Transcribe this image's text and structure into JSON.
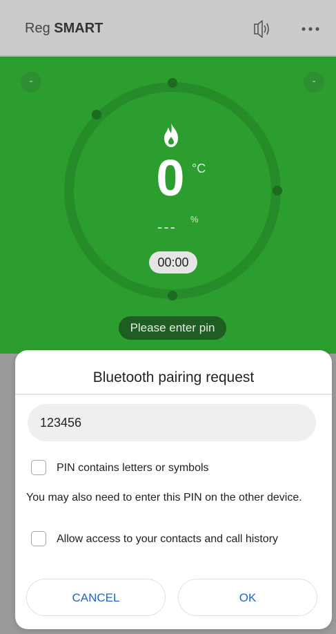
{
  "app_bar": {
    "title_prefix": "Reg ",
    "title_bold": "SMART",
    "speaker_icon": "speaker-icon",
    "more_icon": "more-icon"
  },
  "thermostat": {
    "corner_left": "-",
    "corner_right": "-",
    "flame_icon": "flame-icon",
    "temperature": "0",
    "temperature_unit": "°C",
    "humidity": "---",
    "humidity_unit": "%",
    "time": "00:00",
    "status": "Please enter pin",
    "colors": {
      "background": "#2c9e2f",
      "ring": "#268c29",
      "knob": "#1d6a20"
    }
  },
  "dialog": {
    "title": "Bluetooth pairing request",
    "pin_value": "123456",
    "checkbox_letters_label": "PIN contains letters or symbols",
    "info_text": "You may also need to enter this PIN on the other device.",
    "checkbox_contacts_label": "Allow access to your contacts and call history",
    "cancel_label": "CANCEL",
    "ok_label": "OK",
    "accent_color": "#2464c6"
  }
}
